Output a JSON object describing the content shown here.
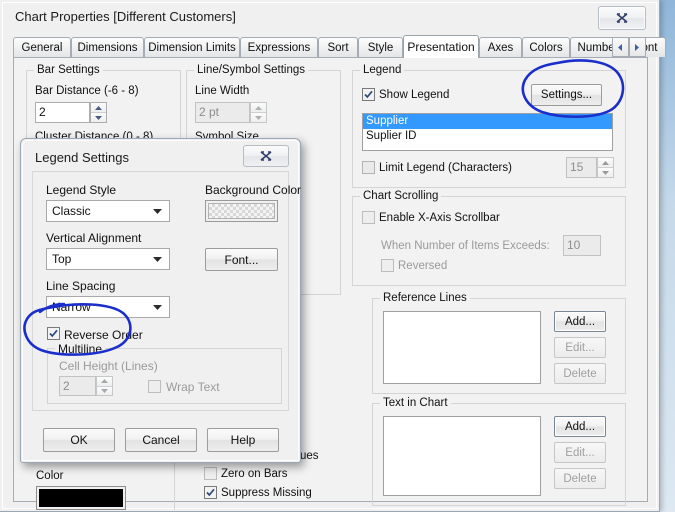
{
  "window": {
    "title": "Chart Properties [Different Customers]",
    "close_label": "Close"
  },
  "tabs": [
    {
      "label": "General",
      "active": false
    },
    {
      "label": "Dimensions",
      "active": false
    },
    {
      "label": "Dimension Limits",
      "active": false
    },
    {
      "label": "Expressions",
      "active": false
    },
    {
      "label": "Sort",
      "active": false
    },
    {
      "label": "Style",
      "active": false
    },
    {
      "label": "Presentation",
      "active": true
    },
    {
      "label": "Axes",
      "active": false
    },
    {
      "label": "Colors",
      "active": false
    },
    {
      "label": "Number",
      "active": false
    },
    {
      "label": "Font",
      "active": false
    }
  ],
  "tab_nav": {
    "prev": "◄",
    "next": "►"
  },
  "bar_settings": {
    "group_label": "Bar Settings",
    "bar_distance_label": "Bar Distance (-6 - 8)",
    "bar_distance_value": "2",
    "cluster_distance_label": "Cluster Distance (0 - 8)"
  },
  "line_symbol_settings": {
    "group_label": "Line/Symbol Settings",
    "line_width_label": "Line Width",
    "line_width_value": "2 pt",
    "symbol_size_label": "Symbol Size"
  },
  "legend_group": {
    "group_label": "Legend",
    "show_legend_label": "Show Legend",
    "show_legend_checked": true,
    "settings_button": "Settings...",
    "items": [
      {
        "label": "Supplier",
        "selected": true
      },
      {
        "label": "Suplier ID",
        "selected": false
      }
    ],
    "limit_legend_label": "Limit Legend (Characters)",
    "limit_legend_checked": false,
    "limit_legend_value": "15"
  },
  "chart_scrolling": {
    "group_label": "Chart Scrolling",
    "enable_scrollbar_label": "Enable X-Axis Scrollbar",
    "enable_scrollbar_checked": false,
    "items_exceeds_label": "When Number of Items Exceeds:",
    "items_exceeds_value": "10",
    "reversed_label": "Reversed",
    "reversed_checked": false
  },
  "reference_lines": {
    "group_label": "Reference Lines",
    "items": [],
    "add_button": "Add...",
    "edit_button": "Edit...",
    "delete_button": "Delete"
  },
  "text_in_chart": {
    "group_label": "Text in Chart",
    "items": [],
    "add_button": "Add...",
    "edit_button": "Edit...",
    "delete_button": "Delete"
  },
  "bottom_left": {
    "color_label": "Color",
    "color_value": "#000000"
  },
  "bottom_middle": {
    "values_label": "alues",
    "zero_on_bars_label": "Zero on Bars",
    "zero_on_bars_checked": false,
    "suppress_missing_label": "Suppress Missing",
    "suppress_missing_checked": true
  },
  "modal": {
    "title": "Legend Settings",
    "close_label": "Close",
    "legend_style_label": "Legend Style",
    "legend_style_value": "Classic",
    "background_color_label": "Background Color",
    "background_color_value": "transparent",
    "vertical_alignment_label": "Vertical Alignment",
    "vertical_alignment_value": "Top",
    "font_button": "Font...",
    "line_spacing_label": "Line Spacing",
    "line_spacing_value": "Narrow",
    "reverse_order_label": "Reverse Order",
    "reverse_order_checked": true,
    "multiline_label": "Multiline",
    "cell_height_label": "Cell Height (Lines)",
    "cell_height_value": "2",
    "wrap_text_label": "Wrap Text",
    "wrap_text_checked": false,
    "ok_button": "OK",
    "cancel_button": "Cancel",
    "help_button": "Help"
  },
  "annotations": {
    "ink_color": "#1a2ecc",
    "circle_settings": "hand-drawn circle around Settings... button",
    "circle_reverse_order": "hand-drawn circle around Reverse Order checkbox"
  }
}
